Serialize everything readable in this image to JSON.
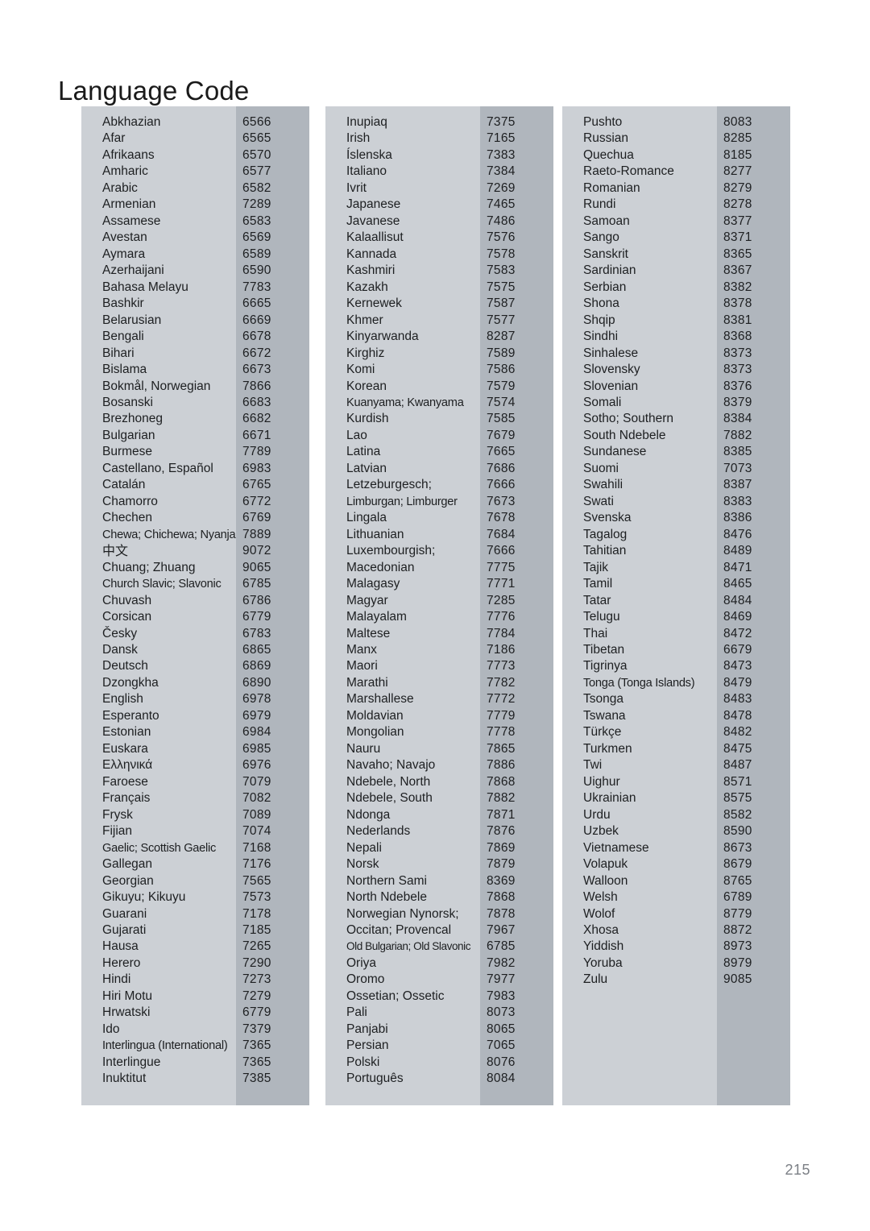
{
  "document": {
    "title": "Language Code",
    "page_number": "215"
  },
  "colors": {
    "name_column_background": "#ccd0d5",
    "code_column_background": "#b0b6bd",
    "text": "#1d1f21",
    "page_number": "#7b7f85",
    "page_background": "#ffffff"
  },
  "columns": [
    {
      "rows": [
        {
          "name": "Abkhazian",
          "code": "6566"
        },
        {
          "name": "Afar",
          "code": "6565"
        },
        {
          "name": "Afrikaans",
          "code": "6570"
        },
        {
          "name": "Amharic",
          "code": "6577"
        },
        {
          "name": "Arabic",
          "code": "6582"
        },
        {
          "name": "Armenian",
          "code": "7289"
        },
        {
          "name": "Assamese",
          "code": "6583"
        },
        {
          "name": "Avestan",
          "code": "6569"
        },
        {
          "name": "Aymara",
          "code": "6589"
        },
        {
          "name": "Azerhaijani",
          "code": "6590"
        },
        {
          "name": "Bahasa Melayu",
          "code": "7783"
        },
        {
          "name": "Bashkir",
          "code": "6665"
        },
        {
          "name": "Belarusian",
          "code": "6669"
        },
        {
          "name": "Bengali",
          "code": "6678"
        },
        {
          "name": "Bihari",
          "code": "6672"
        },
        {
          "name": "Bislama",
          "code": "6673"
        },
        {
          "name": "Bokmål, Norwegian",
          "code": "7866"
        },
        {
          "name": "Bosanski",
          "code": "6683"
        },
        {
          "name": "Brezhoneg",
          "code": "6682"
        },
        {
          "name": "Bulgarian",
          "code": "6671"
        },
        {
          "name": "Burmese",
          "code": "7789"
        },
        {
          "name": "Castellano, Español",
          "code": "6983"
        },
        {
          "name": "Catalán",
          "code": "6765"
        },
        {
          "name": "Chamorro",
          "code": "6772"
        },
        {
          "name": "Chechen",
          "code": "6769"
        },
        {
          "name": "Chewa; Chichewa; Nyanja",
          "code": "7889",
          "fit": "squeeze"
        },
        {
          "name": "中文",
          "code": "9072",
          "script": "cjk"
        },
        {
          "name": "Chuang; Zhuang",
          "code": "9065"
        },
        {
          "name": "Church Slavic; Slavonic",
          "code": "6785",
          "fit": "squeeze"
        },
        {
          "name": "Chuvash",
          "code": "6786"
        },
        {
          "name": "Corsican",
          "code": "6779"
        },
        {
          "name": "Česky",
          "code": "6783"
        },
        {
          "name": "Dansk",
          "code": "6865"
        },
        {
          "name": "Deutsch",
          "code": "6869"
        },
        {
          "name": "Dzongkha",
          "code": "6890"
        },
        {
          "name": "English",
          "code": "6978"
        },
        {
          "name": "Esperanto",
          "code": "6979"
        },
        {
          "name": "Estonian",
          "code": "6984"
        },
        {
          "name": "Euskara",
          "code": "6985"
        },
        {
          "name": "Ελληνικά",
          "code": "6976"
        },
        {
          "name": "Faroese",
          "code": "7079"
        },
        {
          "name": "Français",
          "code": "7082"
        },
        {
          "name": "Frysk",
          "code": "7089"
        },
        {
          "name": "Fijian",
          "code": "7074"
        },
        {
          "name": "Gaelic; Scottish Gaelic",
          "code": "7168",
          "fit": "squeeze"
        },
        {
          "name": "Gallegan",
          "code": "7176"
        },
        {
          "name": "Georgian",
          "code": "7565"
        },
        {
          "name": "Gikuyu; Kikuyu",
          "code": "7573"
        },
        {
          "name": "Guarani",
          "code": "7178"
        },
        {
          "name": "Gujarati",
          "code": "7185"
        },
        {
          "name": "Hausa",
          "code": "7265"
        },
        {
          "name": "Herero",
          "code": "7290"
        },
        {
          "name": "Hindi",
          "code": "7273"
        },
        {
          "name": "Hiri Motu",
          "code": "7279"
        },
        {
          "name": "Hrwatski",
          "code": "6779"
        },
        {
          "name": "Ido",
          "code": "7379"
        },
        {
          "name": "Interlingua (International)",
          "code": "7365",
          "fit": "squeeze"
        },
        {
          "name": "Interlingue",
          "code": "7365"
        },
        {
          "name": "Inuktitut",
          "code": "7385"
        }
      ]
    },
    {
      "rows": [
        {
          "name": "Inupiaq",
          "code": "7375"
        },
        {
          "name": "Irish",
          "code": "7165"
        },
        {
          "name": "Íslenska",
          "code": "7383"
        },
        {
          "name": "Italiano",
          "code": "7384"
        },
        {
          "name": "Ivrit",
          "code": "7269"
        },
        {
          "name": "Japanese",
          "code": "7465"
        },
        {
          "name": "Javanese",
          "code": "7486"
        },
        {
          "name": "Kalaallisut",
          "code": "7576"
        },
        {
          "name": "Kannada",
          "code": "7578"
        },
        {
          "name": "Kashmiri",
          "code": "7583"
        },
        {
          "name": "Kazakh",
          "code": "7575"
        },
        {
          "name": "Kernewek",
          "code": "7587"
        },
        {
          "name": "Khmer",
          "code": "7577"
        },
        {
          "name": "Kinyarwanda",
          "code": "8287"
        },
        {
          "name": "Kirghiz",
          "code": "7589"
        },
        {
          "name": "Komi",
          "code": "7586"
        },
        {
          "name": "Korean",
          "code": "7579"
        },
        {
          "name": "Kuanyama; Kwanyama",
          "code": "7574",
          "fit": "squeeze"
        },
        {
          "name": "Kurdish",
          "code": "7585"
        },
        {
          "name": "Lao",
          "code": "7679"
        },
        {
          "name": "Latina",
          "code": "7665"
        },
        {
          "name": "Latvian",
          "code": "7686"
        },
        {
          "name": "Letzeburgesch;",
          "code": "7666"
        },
        {
          "name": "Limburgan; Limburger",
          "code": "7673",
          "fit": "squeeze"
        },
        {
          "name": "Lingala",
          "code": "7678"
        },
        {
          "name": "Lithuanian",
          "code": "7684"
        },
        {
          "name": "Luxembourgish;",
          "code": "7666"
        },
        {
          "name": "Macedonian",
          "code": "7775"
        },
        {
          "name": "Malagasy",
          "code": "7771"
        },
        {
          "name": "Magyar",
          "code": "7285"
        },
        {
          "name": "Malayalam",
          "code": "7776"
        },
        {
          "name": "Maltese",
          "code": "7784"
        },
        {
          "name": "Manx",
          "code": "7186"
        },
        {
          "name": "Maori",
          "code": "7773"
        },
        {
          "name": "Marathi",
          "code": "7782"
        },
        {
          "name": "Marshallese",
          "code": "7772"
        },
        {
          "name": "Moldavian",
          "code": "7779"
        },
        {
          "name": "Mongolian",
          "code": "7778"
        },
        {
          "name": "Nauru",
          "code": "7865"
        },
        {
          "name": "Navaho; Navajo",
          "code": "7886"
        },
        {
          "name": "Ndebele, North",
          "code": "7868"
        },
        {
          "name": "Ndebele, South",
          "code": "7882"
        },
        {
          "name": "Ndonga",
          "code": "7871"
        },
        {
          "name": "Nederlands",
          "code": "7876"
        },
        {
          "name": "Nepali",
          "code": "7869"
        },
        {
          "name": "Norsk",
          "code": "7879"
        },
        {
          "name": "Northern Sami",
          "code": "8369"
        },
        {
          "name": "North Ndebele",
          "code": "7868"
        },
        {
          "name": "Norwegian Nynorsk;",
          "code": "7878"
        },
        {
          "name": "Occitan; Provencal",
          "code": "7967"
        },
        {
          "name": "Old Bulgarian; Old Slavonic",
          "code": "6785",
          "fit": "squeeze-hard"
        },
        {
          "name": "Oriya",
          "code": "7982"
        },
        {
          "name": "Oromo",
          "code": "7977"
        },
        {
          "name": "Ossetian; Ossetic",
          "code": "7983"
        },
        {
          "name": "Pali",
          "code": "8073"
        },
        {
          "name": "Panjabi",
          "code": "8065"
        },
        {
          "name": "Persian",
          "code": "7065"
        },
        {
          "name": "Polski",
          "code": "8076"
        },
        {
          "name": "Português",
          "code": "8084"
        }
      ]
    },
    {
      "rows": [
        {
          "name": "Pushto",
          "code": "8083"
        },
        {
          "name": "Russian",
          "code": "8285"
        },
        {
          "name": "Quechua",
          "code": "8185"
        },
        {
          "name": "Raeto-Romance",
          "code": "8277"
        },
        {
          "name": "Romanian",
          "code": "8279"
        },
        {
          "name": "Rundi",
          "code": "8278"
        },
        {
          "name": "Samoan",
          "code": "8377"
        },
        {
          "name": "Sango",
          "code": "8371"
        },
        {
          "name": "Sanskrit",
          "code": "8365"
        },
        {
          "name": "Sardinian",
          "code": "8367"
        },
        {
          "name": "Serbian",
          "code": "8382"
        },
        {
          "name": "Shona",
          "code": "8378"
        },
        {
          "name": "Shqip",
          "code": "8381"
        },
        {
          "name": "Sindhi",
          "code": "8368"
        },
        {
          "name": "Sinhalese",
          "code": "8373"
        },
        {
          "name": "Slovensky",
          "code": "8373"
        },
        {
          "name": "Slovenian",
          "code": "8376"
        },
        {
          "name": "Somali",
          "code": "8379"
        },
        {
          "name": "Sotho; Southern",
          "code": "8384"
        },
        {
          "name": "South Ndebele",
          "code": "7882"
        },
        {
          "name": "Sundanese",
          "code": "8385"
        },
        {
          "name": "Suomi",
          "code": "7073"
        },
        {
          "name": "Swahili",
          "code": "8387"
        },
        {
          "name": "Swati",
          "code": "8383"
        },
        {
          "name": "Svenska",
          "code": "8386"
        },
        {
          "name": "Tagalog",
          "code": "8476"
        },
        {
          "name": "Tahitian",
          "code": "8489"
        },
        {
          "name": "Tajik",
          "code": "8471"
        },
        {
          "name": "Tamil",
          "code": "8465"
        },
        {
          "name": "Tatar",
          "code": "8484"
        },
        {
          "name": "Telugu",
          "code": "8469"
        },
        {
          "name": "Thai",
          "code": "8472"
        },
        {
          "name": "Tibetan",
          "code": "6679"
        },
        {
          "name": "Tigrinya",
          "code": "8473"
        },
        {
          "name": "Tonga (Tonga Islands)",
          "code": "8479",
          "fit": "squeeze"
        },
        {
          "name": "Tsonga",
          "code": "8483"
        },
        {
          "name": "Tswana",
          "code": "8478"
        },
        {
          "name": "Türkçe",
          "code": "8482"
        },
        {
          "name": "Turkmen",
          "code": "8475"
        },
        {
          "name": "Twi",
          "code": "8487"
        },
        {
          "name": "Uighur",
          "code": "8571"
        },
        {
          "name": "Ukrainian",
          "code": "8575"
        },
        {
          "name": "Urdu",
          "code": "8582"
        },
        {
          "name": "Uzbek",
          "code": "8590"
        },
        {
          "name": "Vietnamese",
          "code": "8673"
        },
        {
          "name": "Volapuk",
          "code": "8679"
        },
        {
          "name": "Walloon",
          "code": "8765"
        },
        {
          "name": "Welsh",
          "code": "6789"
        },
        {
          "name": "Wolof",
          "code": "8779"
        },
        {
          "name": "Xhosa",
          "code": "8872"
        },
        {
          "name": "Yiddish",
          "code": "8973"
        },
        {
          "name": "Yoruba",
          "code": "8979"
        },
        {
          "name": "Zulu",
          "code": "9085"
        }
      ]
    }
  ]
}
